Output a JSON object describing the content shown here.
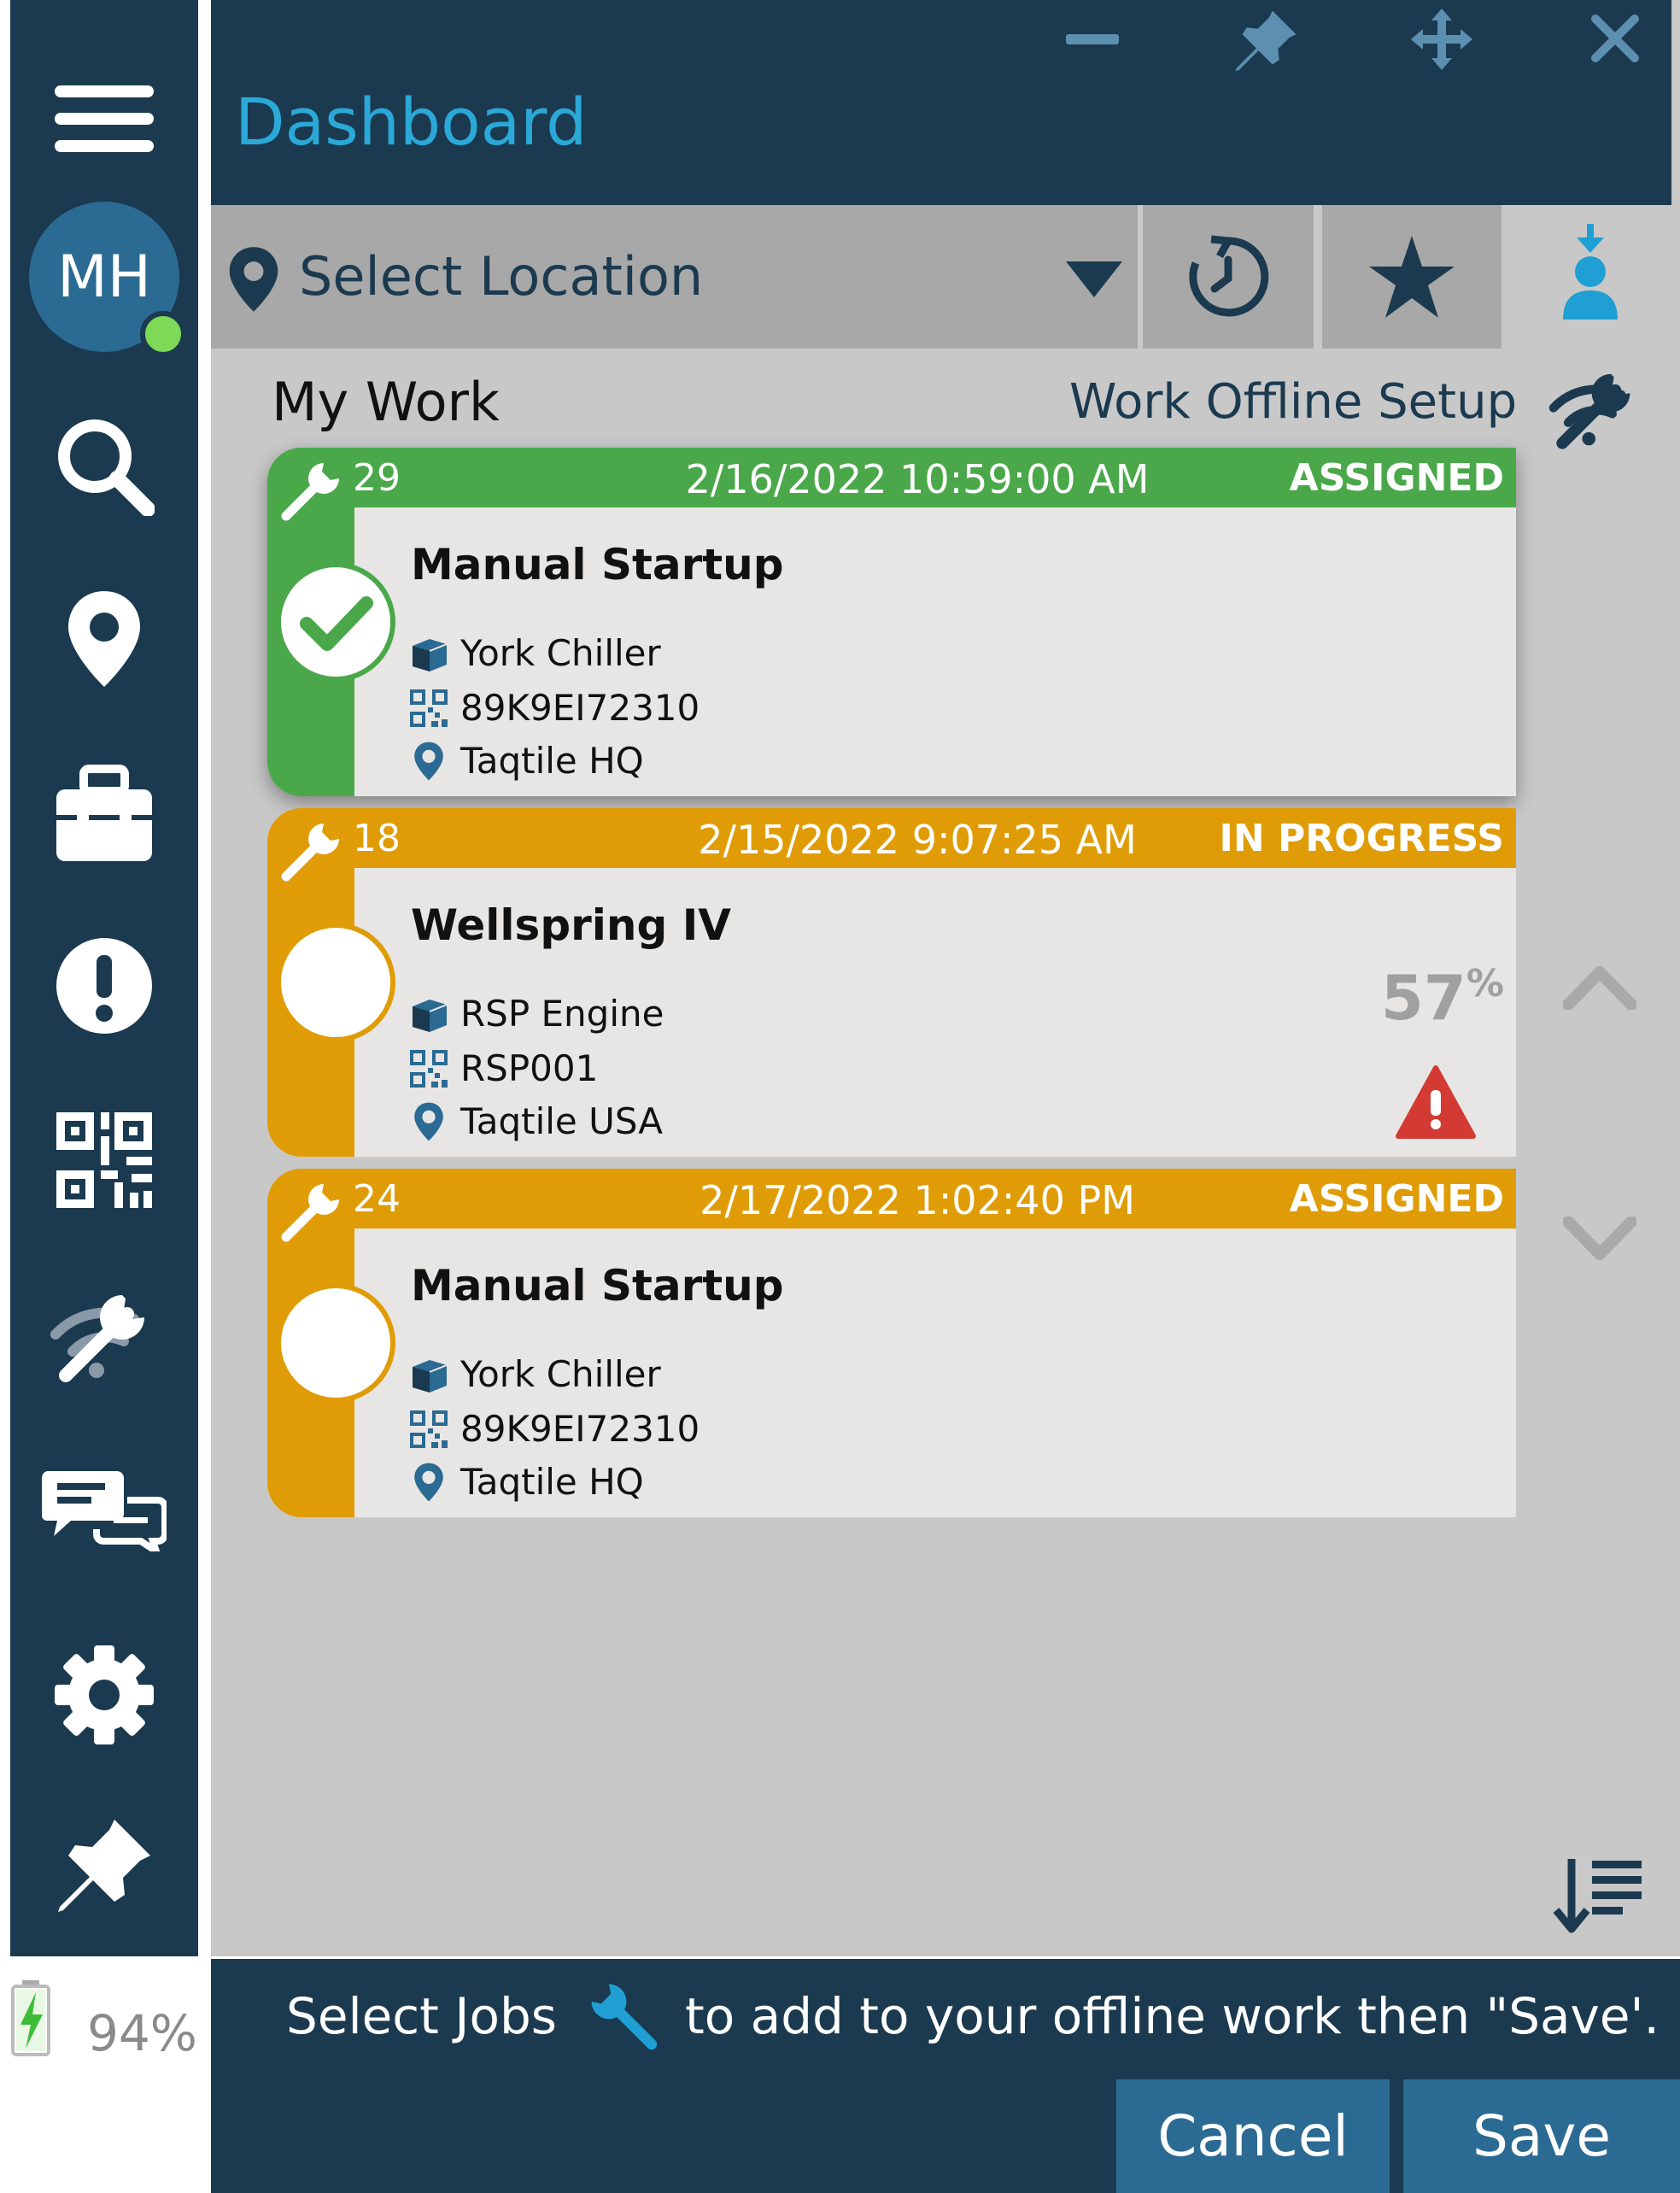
{
  "header": {
    "title": "Dashboard",
    "window_controls": [
      "minimize-icon",
      "pin-icon",
      "move-icon",
      "close-icon"
    ]
  },
  "sidebar": {
    "avatar_initials": "MH",
    "online_status_color": "#7ed957",
    "items": [
      "menu-icon",
      "search-icon",
      "location-icon",
      "toolbox-icon",
      "alert-icon",
      "qr-code-icon",
      "offline-wrench-icon",
      "chat-icon",
      "settings-icon",
      "pin-icon"
    ]
  },
  "battery": {
    "percent": "94%",
    "level": 0.94
  },
  "location_bar": {
    "label": "Select Location",
    "buttons": [
      "history-icon",
      "favorite-star-icon",
      "assigned-user-icon"
    ]
  },
  "my_work": {
    "title": "My Work",
    "offline_setup_label": "Work Offline Setup",
    "cards": [
      {
        "number": "29",
        "date": "2/16/2022 10:59:00 AM",
        "status": "ASSIGNED",
        "name": "Manual Startup",
        "asset": "York Chiller",
        "code": "89K9EI72310",
        "location": "Taqtile HQ",
        "color": "#4aa84a",
        "checked": true
      },
      {
        "number": "18",
        "date": "2/15/2022 9:07:25 AM",
        "status": "IN PROGRESS",
        "name": "Wellspring IV",
        "asset": "RSP Engine",
        "code": "RSP001",
        "location": "Taqtile USA",
        "color": "#e09c06",
        "progress_value": "57",
        "progress_unit": "%",
        "warning": true
      },
      {
        "number": "24",
        "date": "2/17/2022 1:02:40 PM",
        "status": "ASSIGNED",
        "name": "Manual Startup",
        "asset": "York Chiller",
        "code": "89K9EI72310",
        "location": "Taqtile HQ",
        "color": "#e09c06"
      }
    ]
  },
  "footer": {
    "hint_before": "Select Jobs",
    "hint_after": "to add to your offline work then \"Save'.",
    "cancel_label": "Cancel",
    "save_label": "Save"
  },
  "colors": {
    "navy": "#1b3a4f",
    "accent": "#2aa9d8",
    "assigned_green": "#4aa84a",
    "in_progress_amber": "#e09c06",
    "warning_red": "#d33a34"
  }
}
